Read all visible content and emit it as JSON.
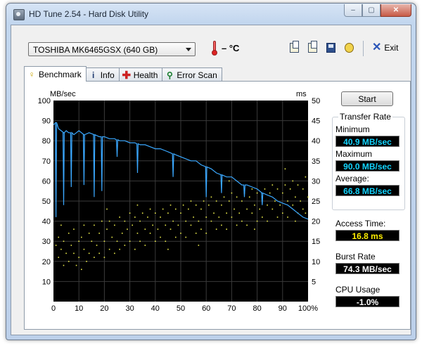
{
  "window": {
    "title": "HD Tune 2.54 - Hard Disk Utility",
    "controls": {
      "minimize": "–",
      "maximize": "▢",
      "close": "✕"
    }
  },
  "toolbar": {
    "drive": "TOSHIBA MK6465GSX (640 GB)",
    "temperature": "– °C",
    "exit_label": "Exit",
    "icons": [
      "copy-text-icon",
      "copy-image-icon",
      "save-icon",
      "options-icon"
    ]
  },
  "tabs": [
    {
      "label": "Benchmark",
      "icon": "benchmark-icon",
      "active": true
    },
    {
      "label": "Info",
      "icon": "info-icon",
      "active": false
    },
    {
      "label": "Health",
      "icon": "health-icon",
      "active": false
    },
    {
      "label": "Error Scan",
      "icon": "error-scan-icon",
      "active": false
    }
  ],
  "benchmark": {
    "start_label": "Start",
    "transfer_rate_title": "Transfer Rate",
    "minimum_label": "Minimum",
    "minimum_value": "40.9 MB/sec",
    "maximum_label": "Maximum",
    "maximum_value": "90.0 MB/sec",
    "average_label": "Average:",
    "average_value": "66.8 MB/sec",
    "access_time_label": "Access Time:",
    "access_time_value": "16.8 ms",
    "burst_rate_label": "Burst Rate",
    "burst_rate_value": "74.3 MB/sec",
    "cpu_usage_label": "CPU Usage",
    "cpu_usage_value": "-1.0%"
  },
  "chart_data": {
    "type": "line",
    "ylabel_left": "MB/sec",
    "ylabel_right": "ms",
    "x_ticks": [
      "0",
      "10",
      "20",
      "30",
      "40",
      "50",
      "60",
      "70",
      "80",
      "90",
      "100%"
    ],
    "y_left_ticks": [
      "10",
      "20",
      "30",
      "40",
      "50",
      "60",
      "70",
      "80",
      "90",
      "100"
    ],
    "y_right_ticks": [
      "5",
      "10",
      "15",
      "20",
      "25",
      "30",
      "35",
      "40",
      "45",
      "50"
    ],
    "xlim": [
      0,
      100
    ],
    "ylim_left": [
      0,
      100
    ],
    "ylim_right": [
      0,
      50
    ],
    "grid": true,
    "background": "#000000",
    "series": [
      {
        "kind": "transfer-rate",
        "color": "#3aa8ff",
        "x": [
          0,
          1,
          2,
          3,
          4,
          5,
          6,
          7,
          8,
          9,
          10,
          12,
          14,
          16,
          18,
          20,
          22,
          24,
          26,
          28,
          30,
          32,
          34,
          36,
          38,
          40,
          42,
          44,
          46,
          48,
          50,
          52,
          54,
          56,
          58,
          60,
          62,
          64,
          66,
          68,
          70,
          72,
          74,
          76,
          78,
          80,
          82,
          84,
          86,
          88,
          90,
          92,
          94,
          96,
          98,
          100
        ],
        "y": [
          88,
          89,
          86,
          85,
          84,
          85,
          84,
          84,
          83,
          84,
          85,
          83,
          84,
          83,
          82,
          82,
          81,
          81,
          80,
          80,
          79,
          79,
          78,
          78,
          77,
          76,
          76,
          75,
          74,
          73,
          72,
          71,
          70,
          70,
          68,
          67,
          66,
          64,
          63,
          62,
          62,
          60,
          58,
          58,
          57,
          56,
          54,
          53,
          52,
          50,
          49,
          48,
          46,
          44,
          42,
          41
        ],
        "dips": [
          {
            "x": 1,
            "y": 42
          },
          {
            "x": 4,
            "y": 48
          },
          {
            "x": 7,
            "y": 57
          },
          {
            "x": 12,
            "y": 58
          },
          {
            "x": 16,
            "y": 52
          },
          {
            "x": 19,
            "y": 55
          },
          {
            "x": 25,
            "y": 72
          },
          {
            "x": 33,
            "y": 64
          },
          {
            "x": 47,
            "y": 62
          },
          {
            "x": 60,
            "y": 52
          },
          {
            "x": 66,
            "y": 54
          },
          {
            "x": 75,
            "y": 52
          },
          {
            "x": 82,
            "y": 48
          }
        ]
      },
      {
        "kind": "access-time",
        "color": "#e8e84a",
        "note_unit": "ms",
        "points": [
          [
            1,
            14
          ],
          [
            2,
            11
          ],
          [
            2,
            16
          ],
          [
            3,
            13
          ],
          [
            4,
            9
          ],
          [
            4,
            15
          ],
          [
            5,
            12
          ],
          [
            6,
            17
          ],
          [
            6,
            10
          ],
          [
            7,
            14
          ],
          [
            8,
            12
          ],
          [
            8,
            18
          ],
          [
            9,
            9
          ],
          [
            10,
            15
          ],
          [
            10,
            11
          ],
          [
            11,
            16
          ],
          [
            12,
            13
          ],
          [
            12,
            19
          ],
          [
            13,
            10
          ],
          [
            14,
            17
          ],
          [
            14,
            12
          ],
          [
            15,
            15
          ],
          [
            16,
            19
          ],
          [
            16,
            11
          ],
          [
            17,
            14
          ],
          [
            18,
            17
          ],
          [
            18,
            12
          ],
          [
            19,
            20
          ],
          [
            20,
            15
          ],
          [
            20,
            11
          ],
          [
            21,
            18
          ],
          [
            22,
            13
          ],
          [
            22,
            20
          ],
          [
            23,
            16
          ],
          [
            24,
            12
          ],
          [
            24,
            19
          ],
          [
            25,
            15
          ],
          [
            26,
            21
          ],
          [
            26,
            13
          ],
          [
            27,
            17
          ],
          [
            28,
            20
          ],
          [
            28,
            14
          ],
          [
            29,
            18
          ],
          [
            30,
            22
          ],
          [
            30,
            15
          ],
          [
            31,
            19
          ],
          [
            32,
            13
          ],
          [
            32,
            21
          ],
          [
            33,
            17
          ],
          [
            34,
            20
          ],
          [
            34,
            15
          ],
          [
            35,
            22
          ],
          [
            36,
            18
          ],
          [
            36,
            14
          ],
          [
            37,
            21
          ],
          [
            38,
            17
          ],
          [
            38,
            23
          ],
          [
            39,
            19
          ],
          [
            40,
            15
          ],
          [
            40,
            22
          ],
          [
            41,
            18
          ],
          [
            42,
            21
          ],
          [
            42,
            16
          ],
          [
            43,
            23
          ],
          [
            44,
            19
          ],
          [
            44,
            15
          ],
          [
            45,
            22
          ],
          [
            46,
            18
          ],
          [
            46,
            24
          ],
          [
            47,
            20
          ],
          [
            48,
            16
          ],
          [
            48,
            23
          ],
          [
            49,
            19
          ],
          [
            50,
            22
          ],
          [
            50,
            17
          ],
          [
            51,
            24
          ],
          [
            52,
            20
          ],
          [
            52,
            16
          ],
          [
            53,
            23
          ],
          [
            54,
            19
          ],
          [
            54,
            25
          ],
          [
            55,
            21
          ],
          [
            56,
            17
          ],
          [
            56,
            24
          ],
          [
            57,
            20
          ],
          [
            58,
            23
          ],
          [
            58,
            18
          ],
          [
            59,
            25
          ],
          [
            60,
            21
          ],
          [
            60,
            17
          ],
          [
            61,
            24
          ],
          [
            62,
            20
          ],
          [
            62,
            26
          ],
          [
            63,
            22
          ],
          [
            64,
            18
          ],
          [
            64,
            25
          ],
          [
            65,
            21
          ],
          [
            66,
            24
          ],
          [
            66,
            19
          ],
          [
            67,
            26
          ],
          [
            68,
            22
          ],
          [
            68,
            18
          ],
          [
            69,
            25
          ],
          [
            70,
            21
          ],
          [
            70,
            27
          ],
          [
            71,
            23
          ],
          [
            72,
            19
          ],
          [
            72,
            26
          ],
          [
            73,
            22
          ],
          [
            74,
            25
          ],
          [
            74,
            20
          ],
          [
            75,
            27
          ],
          [
            76,
            23
          ],
          [
            76,
            19
          ],
          [
            77,
            26
          ],
          [
            78,
            22
          ],
          [
            78,
            28
          ],
          [
            79,
            24
          ],
          [
            80,
            20
          ],
          [
            80,
            27
          ],
          [
            81,
            23
          ],
          [
            82,
            26
          ],
          [
            82,
            21
          ],
          [
            83,
            28
          ],
          [
            84,
            24
          ],
          [
            84,
            20
          ],
          [
            85,
            27
          ],
          [
            86,
            23
          ],
          [
            86,
            29
          ],
          [
            87,
            25
          ],
          [
            88,
            21
          ],
          [
            88,
            28
          ],
          [
            89,
            24
          ],
          [
            90,
            27
          ],
          [
            90,
            22
          ],
          [
            91,
            29
          ],
          [
            92,
            25
          ],
          [
            92,
            21
          ],
          [
            93,
            28
          ],
          [
            94,
            24
          ],
          [
            94,
            30
          ],
          [
            95,
            26
          ],
          [
            96,
            22
          ],
          [
            96,
            29
          ],
          [
            97,
            25
          ],
          [
            98,
            28
          ],
          [
            98,
            23
          ],
          [
            99,
            31
          ],
          [
            100,
            26
          ],
          [
            3,
            19
          ],
          [
            11,
            8
          ],
          [
            21,
            23
          ],
          [
            33,
            24
          ],
          [
            45,
            13
          ],
          [
            57,
            14
          ],
          [
            69,
            30
          ],
          [
            79,
            18
          ],
          [
            91,
            33
          ],
          [
            95,
            20
          ],
          [
            99,
            22
          ]
        ]
      }
    ]
  }
}
